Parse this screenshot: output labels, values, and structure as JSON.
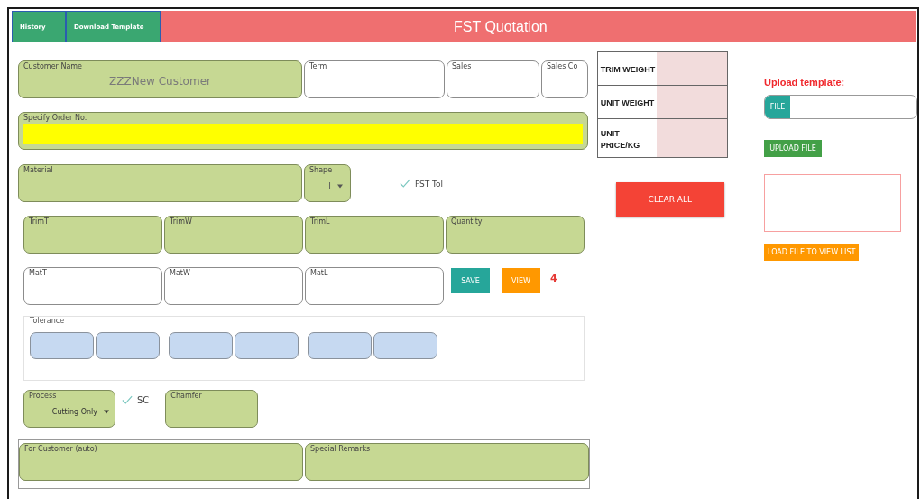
{
  "header": {
    "buttons": [
      {
        "label": "History"
      },
      {
        "label": "Download Template"
      }
    ],
    "title": "FST Quotation"
  },
  "form": {
    "customer_row": [
      {
        "label": "Customer Name",
        "value": "ZZZNew Customer",
        "kind": "required"
      },
      {
        "label": "Term",
        "kind": "optional"
      },
      {
        "label": "Sales",
        "kind": "optional"
      },
      {
        "label": "Sales Co",
        "kind": "optional"
      }
    ],
    "order_no": {
      "label": "Specify Order No.",
      "kind": "highlight"
    },
    "material": {
      "label": "Material",
      "kind": "required"
    },
    "shape": {
      "label": "Shape",
      "value": "I"
    },
    "fst_tol": {
      "label": "FST Tol",
      "checked": true
    },
    "trim_row": [
      {
        "label": "TrimT",
        "kind": "required"
      },
      {
        "label": "TrimW",
        "kind": "required"
      },
      {
        "label": "TrimL",
        "kind": "required"
      },
      {
        "label": "Quantity",
        "kind": "required"
      }
    ],
    "mat_row": [
      {
        "label": "MatT",
        "kind": "optional"
      },
      {
        "label": "MatW",
        "kind": "optional"
      },
      {
        "label": "MatL",
        "kind": "optional"
      }
    ],
    "save_button": "SAVE",
    "view_button": "VIEW",
    "view_count": "4",
    "tolerance": {
      "label": "Tolerance",
      "groups": [
        {
          "fields": [
            {
              "kind": "blank"
            },
            {
              "kind": "blank"
            }
          ]
        },
        {
          "fields": [
            {
              "kind": "blank"
            },
            {
              "kind": "blank"
            }
          ]
        },
        {
          "fields": [
            {
              "kind": "blank"
            },
            {
              "kind": "blank"
            }
          ]
        }
      ]
    },
    "process": {
      "label": "Process",
      "value": "Cutting Only"
    },
    "sc": {
      "label": "SC",
      "checked": true
    },
    "chamfer": {
      "label": "Chamfer",
      "kind": "required"
    },
    "remarks_row": [
      {
        "label": "For Customer (auto)",
        "kind": "required"
      },
      {
        "label": "Special Remarks",
        "kind": "required"
      }
    ]
  },
  "summary": {
    "rows": [
      {
        "label": "TRIM WEIGHT"
      },
      {
        "label": "UNIT WEIGHT"
      },
      {
        "label": "UNIT PRICE/KG"
      }
    ]
  },
  "clear_button": "CLEAR ALL",
  "upload": {
    "title": "Upload template:",
    "file_button": "FILE",
    "upload_button": "UPLOAD FILE",
    "load_button": "LOAD FILE TO VIEW LIST"
  }
}
